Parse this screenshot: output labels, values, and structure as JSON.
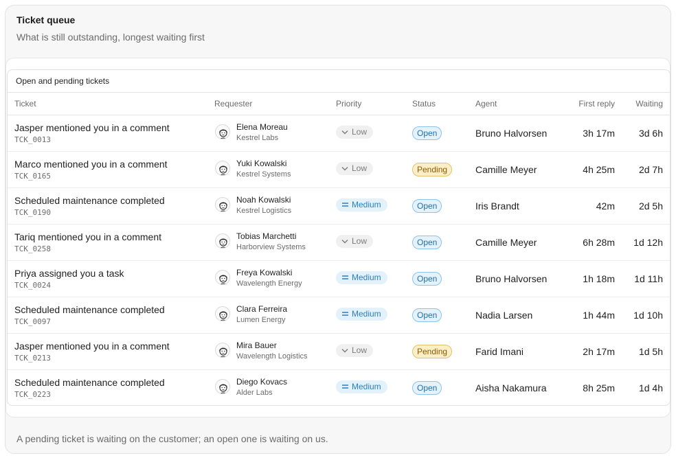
{
  "header": {
    "title": "Ticket queue",
    "subtitle": "What is still outstanding, longest waiting first"
  },
  "table": {
    "caption": "Open and pending tickets",
    "columns": {
      "ticket": "Ticket",
      "requester": "Requester",
      "priority": "Priority",
      "status": "Status",
      "agent": "Agent",
      "first_reply": "First reply",
      "waiting": "Waiting"
    },
    "rows": [
      {
        "title": "Jasper mentioned you in a comment",
        "id": "TCK_0013",
        "requester": "Elena Moreau",
        "org": "Kestrel Labs",
        "priority": "Low",
        "status": "Open",
        "agent": "Bruno Halvorsen",
        "first_reply": "3h 17m",
        "waiting": "3d 6h"
      },
      {
        "title": "Marco mentioned you in a comment",
        "id": "TCK_0165",
        "requester": "Yuki Kowalski",
        "org": "Kestrel Systems",
        "priority": "Low",
        "status": "Pending",
        "agent": "Camille Meyer",
        "first_reply": "4h 25m",
        "waiting": "2d 7h"
      },
      {
        "title": "Scheduled maintenance completed",
        "id": "TCK_0190",
        "requester": "Noah Kowalski",
        "org": "Kestrel Logistics",
        "priority": "Medium",
        "status": "Open",
        "agent": "Iris Brandt",
        "first_reply": "42m",
        "waiting": "2d 5h"
      },
      {
        "title": "Tariq mentioned you in a comment",
        "id": "TCK_0258",
        "requester": "Tobias Marchetti",
        "org": "Harborview Systems",
        "priority": "Low",
        "status": "Open",
        "agent": "Camille Meyer",
        "first_reply": "6h 28m",
        "waiting": "1d 12h"
      },
      {
        "title": "Priya assigned you a task",
        "id": "TCK_0024",
        "requester": "Freya Kowalski",
        "org": "Wavelength Energy",
        "priority": "Medium",
        "status": "Open",
        "agent": "Bruno Halvorsen",
        "first_reply": "1h 18m",
        "waiting": "1d 11h"
      },
      {
        "title": "Scheduled maintenance completed",
        "id": "TCK_0097",
        "requester": "Clara Ferreira",
        "org": "Lumen Energy",
        "priority": "Medium",
        "status": "Open",
        "agent": "Nadia Larsen",
        "first_reply": "1h 44m",
        "waiting": "1d 10h"
      },
      {
        "title": "Jasper mentioned you in a comment",
        "id": "TCK_0213",
        "requester": "Mira Bauer",
        "org": "Wavelength Logistics",
        "priority": "Low",
        "status": "Pending",
        "agent": "Farid Imani",
        "first_reply": "2h 17m",
        "waiting": "1d 5h"
      },
      {
        "title": "Scheduled maintenance completed",
        "id": "TCK_0223",
        "requester": "Diego Kovacs",
        "org": "Alder Labs",
        "priority": "Medium",
        "status": "Open",
        "agent": "Aisha Nakamura",
        "first_reply": "8h 25m",
        "waiting": "1d 4h"
      }
    ]
  },
  "footer": {
    "note": "A pending ticket is waiting on the customer; an open one is waiting on us."
  },
  "icons": {
    "low": "chevron-down-icon",
    "medium": "equals-icon"
  },
  "colors": {
    "open": "#1f6fa8",
    "pending": "#8a5a00",
    "medium": "#2a7fc1"
  }
}
